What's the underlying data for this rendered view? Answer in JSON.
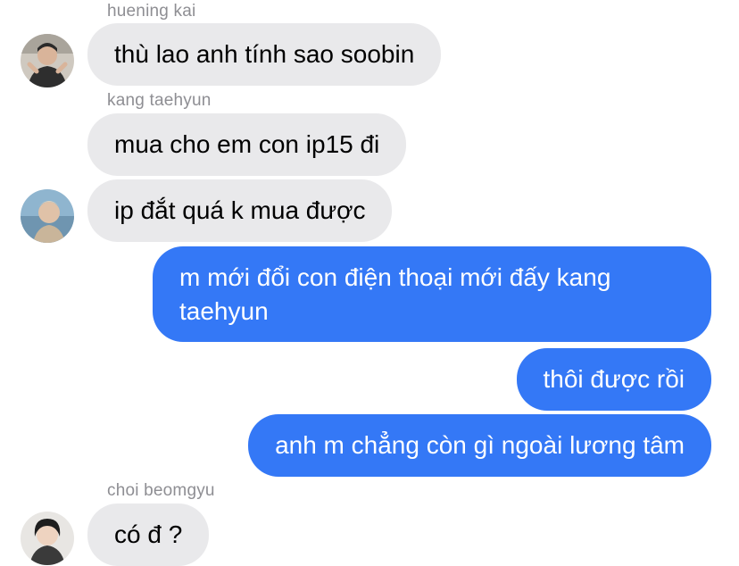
{
  "colors": {
    "incoming_bubble": "#e9e9eb",
    "outgoing_bubble": "#3478f6",
    "sender_name": "#8e8e93"
  },
  "messages": [
    {
      "sender": "hueningkai",
      "sender_name": "huening kai",
      "text": "thù lao anh tính sao soobin",
      "direction": "incoming"
    },
    {
      "sender": "kang taehyun",
      "sender_name": "kang taehyun",
      "text": "mua cho em con ip15 đi",
      "direction": "incoming"
    },
    {
      "sender": "kang taehyun",
      "text": "ip đắt quá k mua được",
      "direction": "incoming"
    },
    {
      "sender": "me",
      "text": "m mới đổi con điện thoại mới đấy kang taehyun",
      "direction": "outgoing"
    },
    {
      "sender": "me",
      "text": "thôi được rồi",
      "direction": "outgoing"
    },
    {
      "sender": "me",
      "text": "anh m chẳng còn gì ngoài lương tâm",
      "direction": "outgoing"
    },
    {
      "sender": "choi beomgyu",
      "sender_name": "choi beomgyu",
      "text": "có đ ?",
      "direction": "incoming"
    }
  ]
}
